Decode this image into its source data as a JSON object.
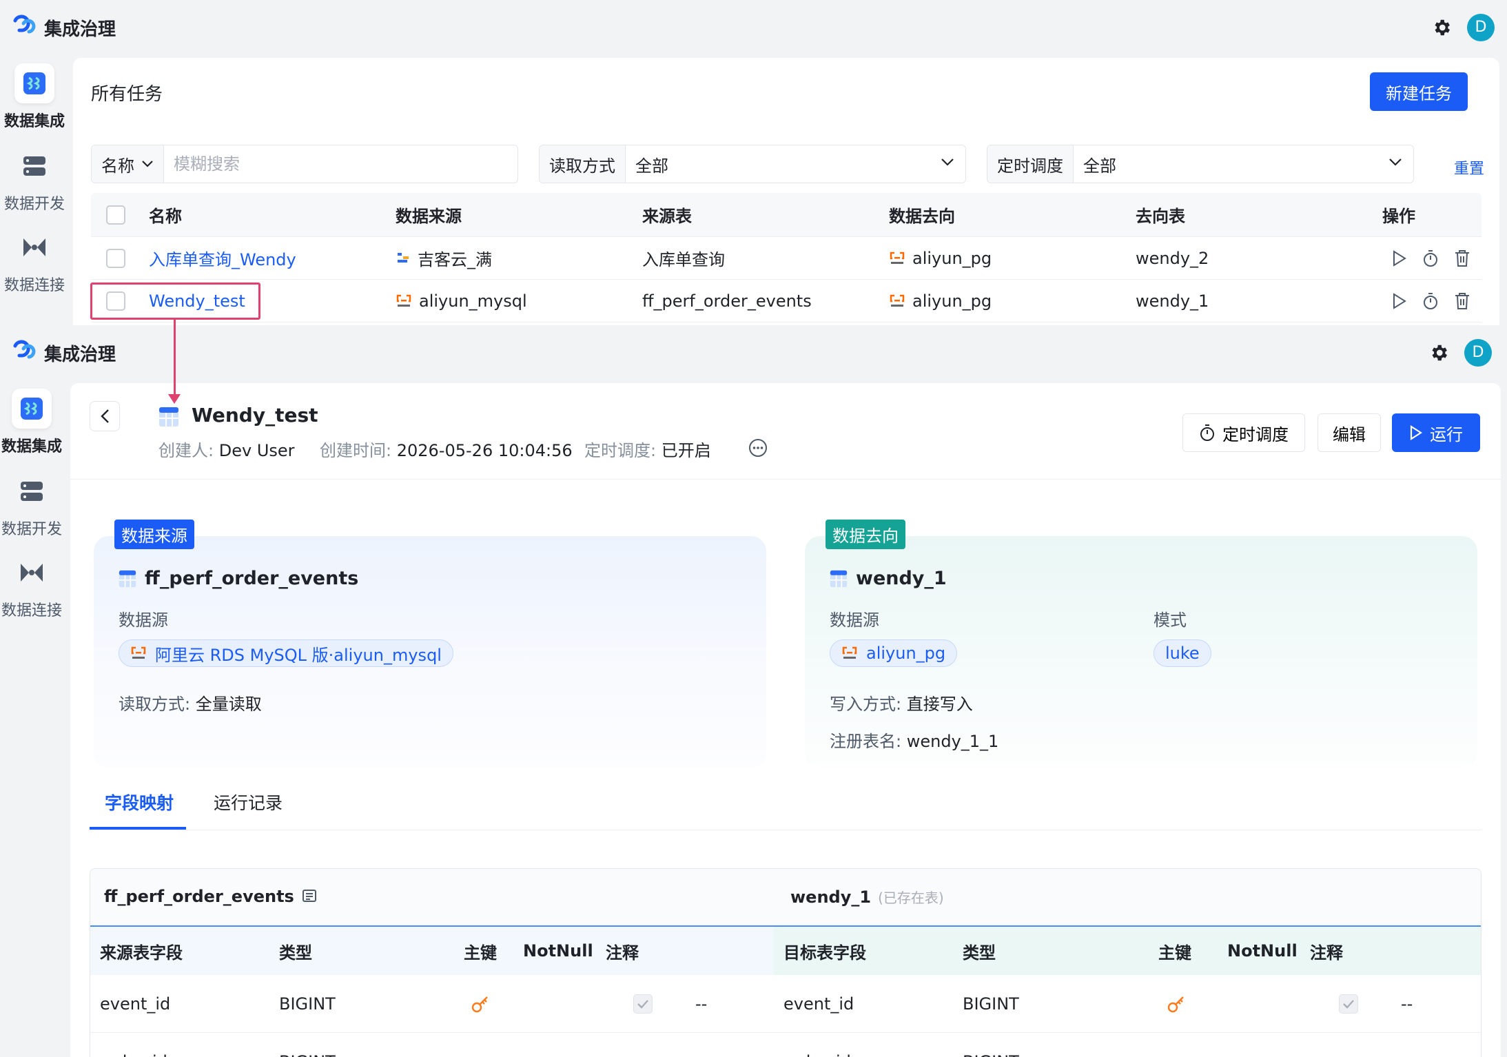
{
  "app": {
    "title": "集成治理",
    "avatar_letter": "D",
    "brand_color": "#1a5cf5"
  },
  "sidebar": {
    "items": [
      {
        "label": "数据集成",
        "icon": "data-integration-icon",
        "active": true
      },
      {
        "label": "数据开发",
        "icon": "data-dev-icon",
        "active": false
      },
      {
        "label": "数据连接",
        "icon": "data-connect-icon",
        "active": false
      }
    ]
  },
  "task_list": {
    "title": "所有任务",
    "new_task_label": "新建任务",
    "filters": {
      "name_label": "名称",
      "search_placeholder": "模糊搜索",
      "read_mode_label": "读取方式",
      "read_mode_value": "全部",
      "schedule_label": "定时调度",
      "schedule_value": "全部",
      "reset_label": "重置"
    },
    "columns": [
      "名称",
      "数据来源",
      "来源表",
      "数据去向",
      "去向表",
      "操作"
    ],
    "rows": [
      {
        "name": "入库单查询_Wendy",
        "source": "吉客云_满",
        "source_table": "入库单查询",
        "target": "aliyun_pg",
        "target_table": "wendy_2"
      },
      {
        "name": "Wendy_test",
        "source": "aliyun_mysql",
        "source_table": "ff_perf_order_events",
        "target": "aliyun_pg",
        "target_table": "wendy_1"
      }
    ]
  },
  "detail": {
    "task_name": "Wendy_test",
    "creator_label": "创建人:",
    "creator": "Dev User",
    "created_label": "创建时间:",
    "created_at": "2026-05-26 10:04:56",
    "schedule_label": "定时调度:",
    "schedule_status": "已开启",
    "btn_schedule": "定时调度",
    "btn_edit": "编辑",
    "btn_run": "运行",
    "source": {
      "tag": "数据来源",
      "table": "ff_perf_order_events",
      "ds_label": "数据源",
      "ds_value": "阿里云 RDS MySQL 版·aliyun_mysql",
      "read_label": "读取方式:",
      "read_value": "全量读取"
    },
    "target": {
      "tag": "数据去向",
      "table": "wendy_1",
      "ds_label": "数据源",
      "ds_value": "aliyun_pg",
      "mode_label": "模式",
      "mode_value": "luke",
      "write_label": "写入方式:",
      "write_value": "直接写入",
      "reg_label": "注册表名:",
      "reg_value": "wendy_1_1"
    },
    "tabs": [
      "字段映射",
      "运行记录"
    ],
    "mapping": {
      "source_table": "ff_perf_order_events",
      "target_table": "wendy_1",
      "exists_note": "(已存在表)",
      "source_headers": [
        "来源表字段",
        "类型",
        "主键",
        "NotNull",
        "注释"
      ],
      "target_headers": [
        "目标表字段",
        "类型",
        "主键",
        "NotNull",
        "注释"
      ],
      "rows": [
        {
          "src_field": "event_id",
          "src_type": "BIGINT",
          "src_comment": "--",
          "dst_field": "event_id",
          "dst_type": "BIGINT",
          "dst_comment": "--"
        },
        {
          "src_field": "order_id",
          "src_type": "BIGINT",
          "src_comment": "--",
          "dst_field": "order_id",
          "dst_type": "BIGINT",
          "dst_comment": "--"
        }
      ]
    }
  }
}
